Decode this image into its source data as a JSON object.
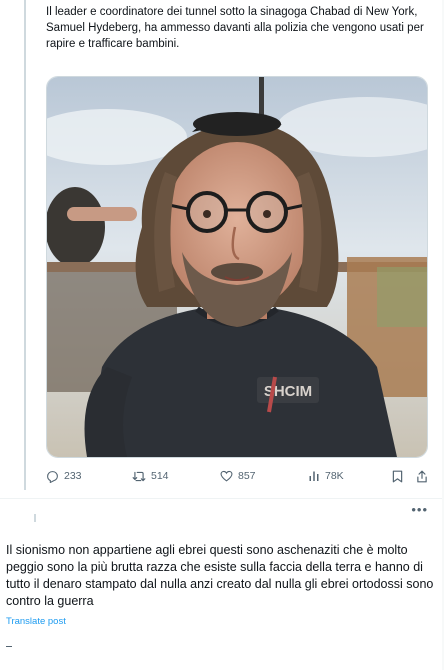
{
  "quoted_post": {
    "text": "Il leader e coordinatore dei tunnel sotto la sinagoga Chabad di New York, Samuel Hydeberg, ha ammesso davanti alla polizia che vengono usati per rapire e trafficare bambini.",
    "image_overlay_text": "SHCIM",
    "actions": {
      "replies": "233",
      "retweets": "514",
      "likes": "857",
      "views": "78K"
    }
  },
  "reply_post": {
    "more_icon": "more-icon",
    "text": "Il sionismo non appartiene agli ebrei questi sono aschenaziti che è molto peggio sono la più brutta razza che esiste sulla faccia della terra e hanno di tutto il denaro stampato dal nulla anzi creato dal nulla gli ebrei ortodossi sono contro la guerra",
    "translate_label": "Translate post"
  },
  "colors": {
    "text": "#0f1419",
    "secondary": "#536471",
    "link": "#1d9bf0",
    "border": "#cfd9de"
  }
}
